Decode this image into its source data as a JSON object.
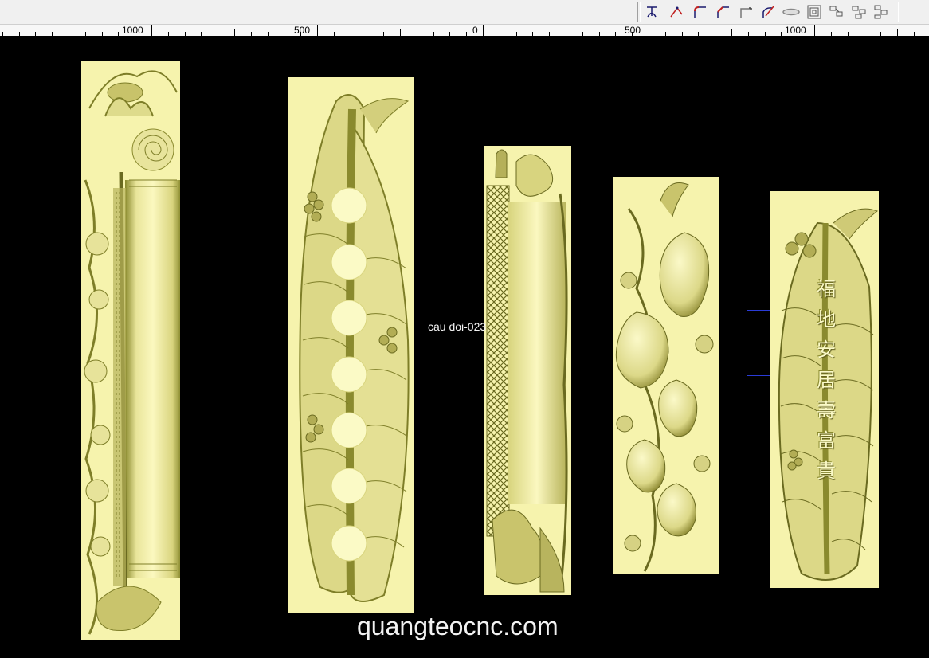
{
  "toolbar": {
    "tools": [
      {
        "icon": "bezier-tool-icon"
      },
      {
        "icon": "line-tool-icon"
      },
      {
        "icon": "fillet-tool-icon"
      },
      {
        "icon": "chamfer-tool-icon"
      },
      {
        "icon": "corner-tool-icon"
      },
      {
        "icon": "trim-tool-icon"
      },
      {
        "icon": "ellipse-tool-icon"
      },
      {
        "icon": "offset-tool-icon"
      },
      {
        "icon": "group-tool-icon"
      },
      {
        "icon": "ungroup-tool-icon"
      },
      {
        "icon": "arrange-tool-icon"
      }
    ]
  },
  "ruler": {
    "labels": [
      "1000",
      "500",
      "0",
      "500",
      "1000"
    ]
  },
  "canvas": {
    "object_label": "cau doi-023",
    "watermark": "quangteocnc.com",
    "panel4_characters": [
      "福",
      "地",
      "安",
      "居",
      "壽",
      "富",
      "貴"
    ]
  },
  "colors": {
    "relief_base": "#f6f3ad",
    "relief_shadow": "#8a8a2e",
    "background": "#000000",
    "selection": "#2a3bd6"
  }
}
